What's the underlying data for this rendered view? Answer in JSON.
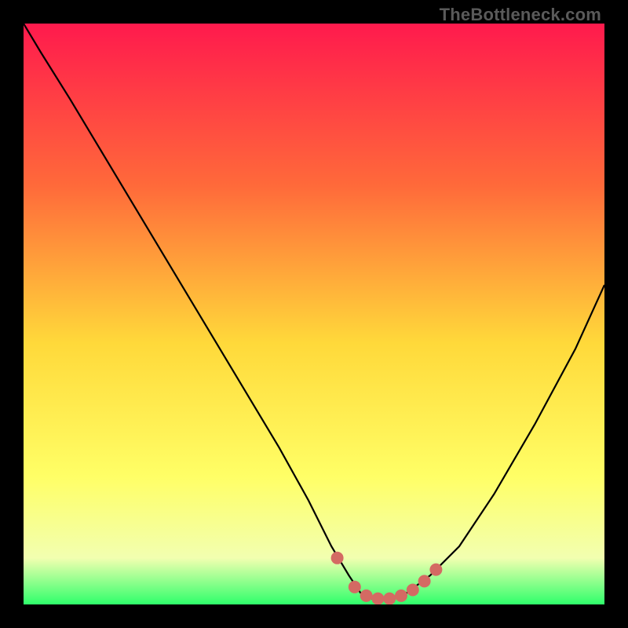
{
  "watermark": "TheBottleneck.com",
  "colors": {
    "gradient_top": "#ff1a4d",
    "gradient_mid1": "#ff6a3a",
    "gradient_mid2": "#ffd93a",
    "gradient_mid3": "#ffff66",
    "gradient_mid4": "#f2ffb0",
    "gradient_bottom": "#2fff6b",
    "curve": "#000000",
    "marker": "#d46a63",
    "marker_stroke": "#d46a63"
  },
  "chart_data": {
    "type": "line",
    "title": "",
    "xlabel": "",
    "ylabel": "",
    "xlim": [
      0,
      100
    ],
    "ylim": [
      0,
      100
    ],
    "series": [
      {
        "name": "bottleneck-curve",
        "x": [
          0,
          3,
          8,
          14,
          20,
          26,
          32,
          38,
          44,
          49,
          53,
          56,
          58,
          60,
          63,
          66,
          70,
          75,
          81,
          88,
          95,
          100
        ],
        "y": [
          100,
          95,
          87,
          77,
          67,
          57,
          47,
          37,
          27,
          18,
          10,
          5,
          2,
          1,
          1,
          2,
          5,
          10,
          19,
          31,
          44,
          55
        ]
      }
    ],
    "markers": {
      "name": "highlight-dots",
      "points": [
        {
          "x": 54,
          "y": 8
        },
        {
          "x": 57,
          "y": 3
        },
        {
          "x": 59,
          "y": 1.5
        },
        {
          "x": 61,
          "y": 1
        },
        {
          "x": 63,
          "y": 1
        },
        {
          "x": 65,
          "y": 1.5
        },
        {
          "x": 67,
          "y": 2.5
        },
        {
          "x": 69,
          "y": 4
        },
        {
          "x": 71,
          "y": 6
        }
      ]
    }
  }
}
